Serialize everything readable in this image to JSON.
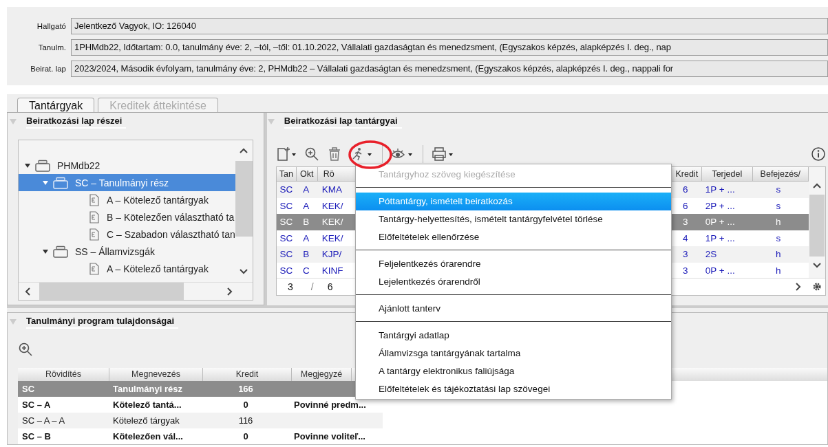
{
  "header_fields": [
    {
      "label": "Hallgató",
      "value": "Jelentkező Vagyok, IO: 126040"
    },
    {
      "label": "Tanulm.",
      "value": "1PHMdb22, Időtartam: 0.0, tanulmány éve: 2,  –tól, –től: 01.10.2022, Vállalati gazdaságtan és menedzsment, (Egyszakos képzés, alapképzés I. deg., nap"
    },
    {
      "label": "Beirat. lap",
      "value": "2023/2024, Második évfolyam, tanulmány éve: 2, PHMdb22 – Vállalati gazdaságtan és menedzsment, (Egyszakos képzés, alapképzés I. deg., nappali for"
    }
  ],
  "tabs": [
    {
      "label": "Tantárgyak",
      "selected": true
    },
    {
      "label": "Kreditek áttekintése",
      "selected": false
    }
  ],
  "parts_panel": {
    "title": "Beiratkozási lap részei",
    "tree": [
      {
        "label": "PHMdb22",
        "kind": "group",
        "expanded": true,
        "selected": false,
        "children": [
          {
            "label": "SC – Tanulmányi rész",
            "kind": "group",
            "expanded": true,
            "selected": true,
            "children": [
              {
                "label": "A – Kötelező tantárgyak",
                "kind": "leaf",
                "selected": false
              },
              {
                "label": "B – Kötelezően választható ta",
                "kind": "leaf",
                "selected": false
              },
              {
                "label": "C – Szabadon választható tan",
                "kind": "leaf",
                "selected": false
              }
            ]
          },
          {
            "label": "SS – Államvizsgák",
            "kind": "group",
            "expanded": true,
            "selected": false,
            "children": [
              {
                "label": "A – Kötelező tantárgyak",
                "kind": "leaf",
                "selected": false
              }
            ]
          }
        ]
      }
    ]
  },
  "subjects_panel": {
    "title": "Beiratkozási lap tantárgyai",
    "columns": [
      "Tan",
      "Okt",
      "Rö",
      "Kredit",
      "Terjedel",
      "Befejezés/"
    ],
    "rows": [
      {
        "cells": [
          "SC",
          "A",
          "KMA",
          "6",
          "1P + ...",
          "s"
        ],
        "selected": false
      },
      {
        "cells": [
          "SC",
          "A",
          "KEK/",
          "6",
          "2P + ...",
          "s"
        ],
        "selected": false
      },
      {
        "cells": [
          "SC",
          "B",
          "KEK/",
          "3",
          "0P + ...",
          "h"
        ],
        "selected": true
      },
      {
        "cells": [
          "SC",
          "A",
          "KEK/",
          "4",
          "1P + ...",
          "s"
        ],
        "selected": false
      },
      {
        "cells": [
          "SC",
          "B",
          "KJP/",
          "3",
          "2S",
          "h"
        ],
        "selected": false
      },
      {
        "cells": [
          "SC",
          "C",
          "KINF",
          "3",
          "0P + ...",
          "h"
        ],
        "selected": false
      }
    ],
    "footer": [
      "3",
      "/",
      "6"
    ]
  },
  "menu": {
    "groups": [
      [
        {
          "label": "Tantárgyhoz szöveg kiegészítése",
          "disabled": true,
          "selected": false
        }
      ],
      [
        {
          "label": "Póttantárgy, ismételt beiratkozás",
          "disabled": false,
          "selected": true
        },
        {
          "label": "Tantárgy-helyettesítés, ismételt tantárgyfelvétel törlése",
          "disabled": false,
          "selected": false
        },
        {
          "label": "Előfeltételek ellenőrzése",
          "disabled": false,
          "selected": false
        }
      ],
      [
        {
          "label": "Feljelentkezés órarendre",
          "disabled": false,
          "selected": false
        },
        {
          "label": "Lejelentkezés órarendről",
          "disabled": false,
          "selected": false
        }
      ],
      [
        {
          "label": "Ajánlott tanterv",
          "disabled": false,
          "selected": false
        }
      ],
      [
        {
          "label": "Tantárgyi adatlap",
          "disabled": false,
          "selected": false
        },
        {
          "label": "Államvizsga tantárgyának tartalma",
          "disabled": false,
          "selected": false
        },
        {
          "label": "A tantárgy elektronikus faliújsága",
          "disabled": false,
          "selected": false
        },
        {
          "label": "Előfeltételek és tájékoztatási lap szövegei",
          "disabled": false,
          "selected": false
        }
      ]
    ]
  },
  "properties_panel": {
    "title": "Tanulmányi program tulajdonságai",
    "columns": [
      "Rövidítés",
      "Megnevezés",
      "Kredit",
      "Megjegyzé"
    ],
    "rows": [
      {
        "cells": [
          "SC",
          "Tanulmányi rész",
          "166",
          ""
        ],
        "bold": true,
        "selected": true
      },
      {
        "cells": [
          "SC – A",
          "Kötelező tantá...",
          "0",
          "Povinné predm..."
        ],
        "bold": true,
        "selected": false
      },
      {
        "cells": [
          "SC – A – A",
          "Kötelező tárgyak",
          "116",
          ""
        ],
        "bold": false,
        "selected": false
      },
      {
        "cells": [
          "SC – B",
          "Kötelezően vál...",
          "0",
          "Povinne voliteľ..."
        ],
        "bold": true,
        "selected": false
      }
    ]
  }
}
